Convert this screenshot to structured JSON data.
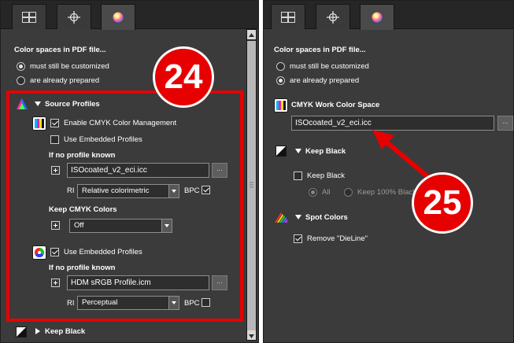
{
  "left": {
    "tabs": [
      {
        "icon": "layout-grid-icon"
      },
      {
        "icon": "crosshair-icon"
      },
      {
        "icon": "color-ball-icon",
        "active": true
      }
    ],
    "section_title": "Color spaces in PDF file...",
    "radio_options": [
      {
        "label": "must still be customized",
        "selected": true
      },
      {
        "label": "are already prepared",
        "selected": false
      }
    ],
    "source_profiles": {
      "heading": "Source Profiles",
      "cmyk": {
        "enable_label": "Enable CMYK Color Management",
        "enable_checked": true,
        "use_embedded_label": "Use Embedded Profiles",
        "use_embedded_checked": false,
        "if_no_profile_label": "If no profile known",
        "profile_value": "ISOcoated_v2_eci.icc",
        "ri_label": "RI",
        "ri_value": "Relative colorimetric",
        "bpc_label": "BPC",
        "bpc_checked": true,
        "keep_cmyk_label": "Keep CMYK Colors",
        "keep_cmyk_value": "Off"
      },
      "rgb": {
        "use_embedded_label": "Use Embedded Profiles",
        "use_embedded_checked": true,
        "if_no_profile_label": "If no profile known",
        "profile_value": "HDM sRGB Profile.icm",
        "ri_label": "RI",
        "ri_value": "Perceptual",
        "bpc_label": "BPC",
        "bpc_checked": false
      }
    },
    "keep_black_label": "Keep Black",
    "browse_label": "...",
    "callout": "24",
    "highlight_color": "#e60000"
  },
  "right": {
    "section_title": "Color spaces in PDF file...",
    "radio_options": [
      {
        "label": "must still be customized",
        "selected": false
      },
      {
        "label": "are already prepared",
        "selected": true
      }
    ],
    "cmyk_work_heading": "CMYK Work Color Space",
    "cmyk_work_value": "ISOcoated_v2_eci.icc",
    "keep_black": {
      "heading": "Keep Black",
      "checkbox_label": "Keep Black",
      "checked": false,
      "option_all": "All",
      "option_keep100": "Keep 100% Black"
    },
    "spot_colors": {
      "heading": "Spot Colors",
      "checkbox_label": "Remove \"DieLine\"",
      "checked": true
    },
    "browse_label": "...",
    "callout": "25",
    "arrow_color": "#e60000"
  }
}
